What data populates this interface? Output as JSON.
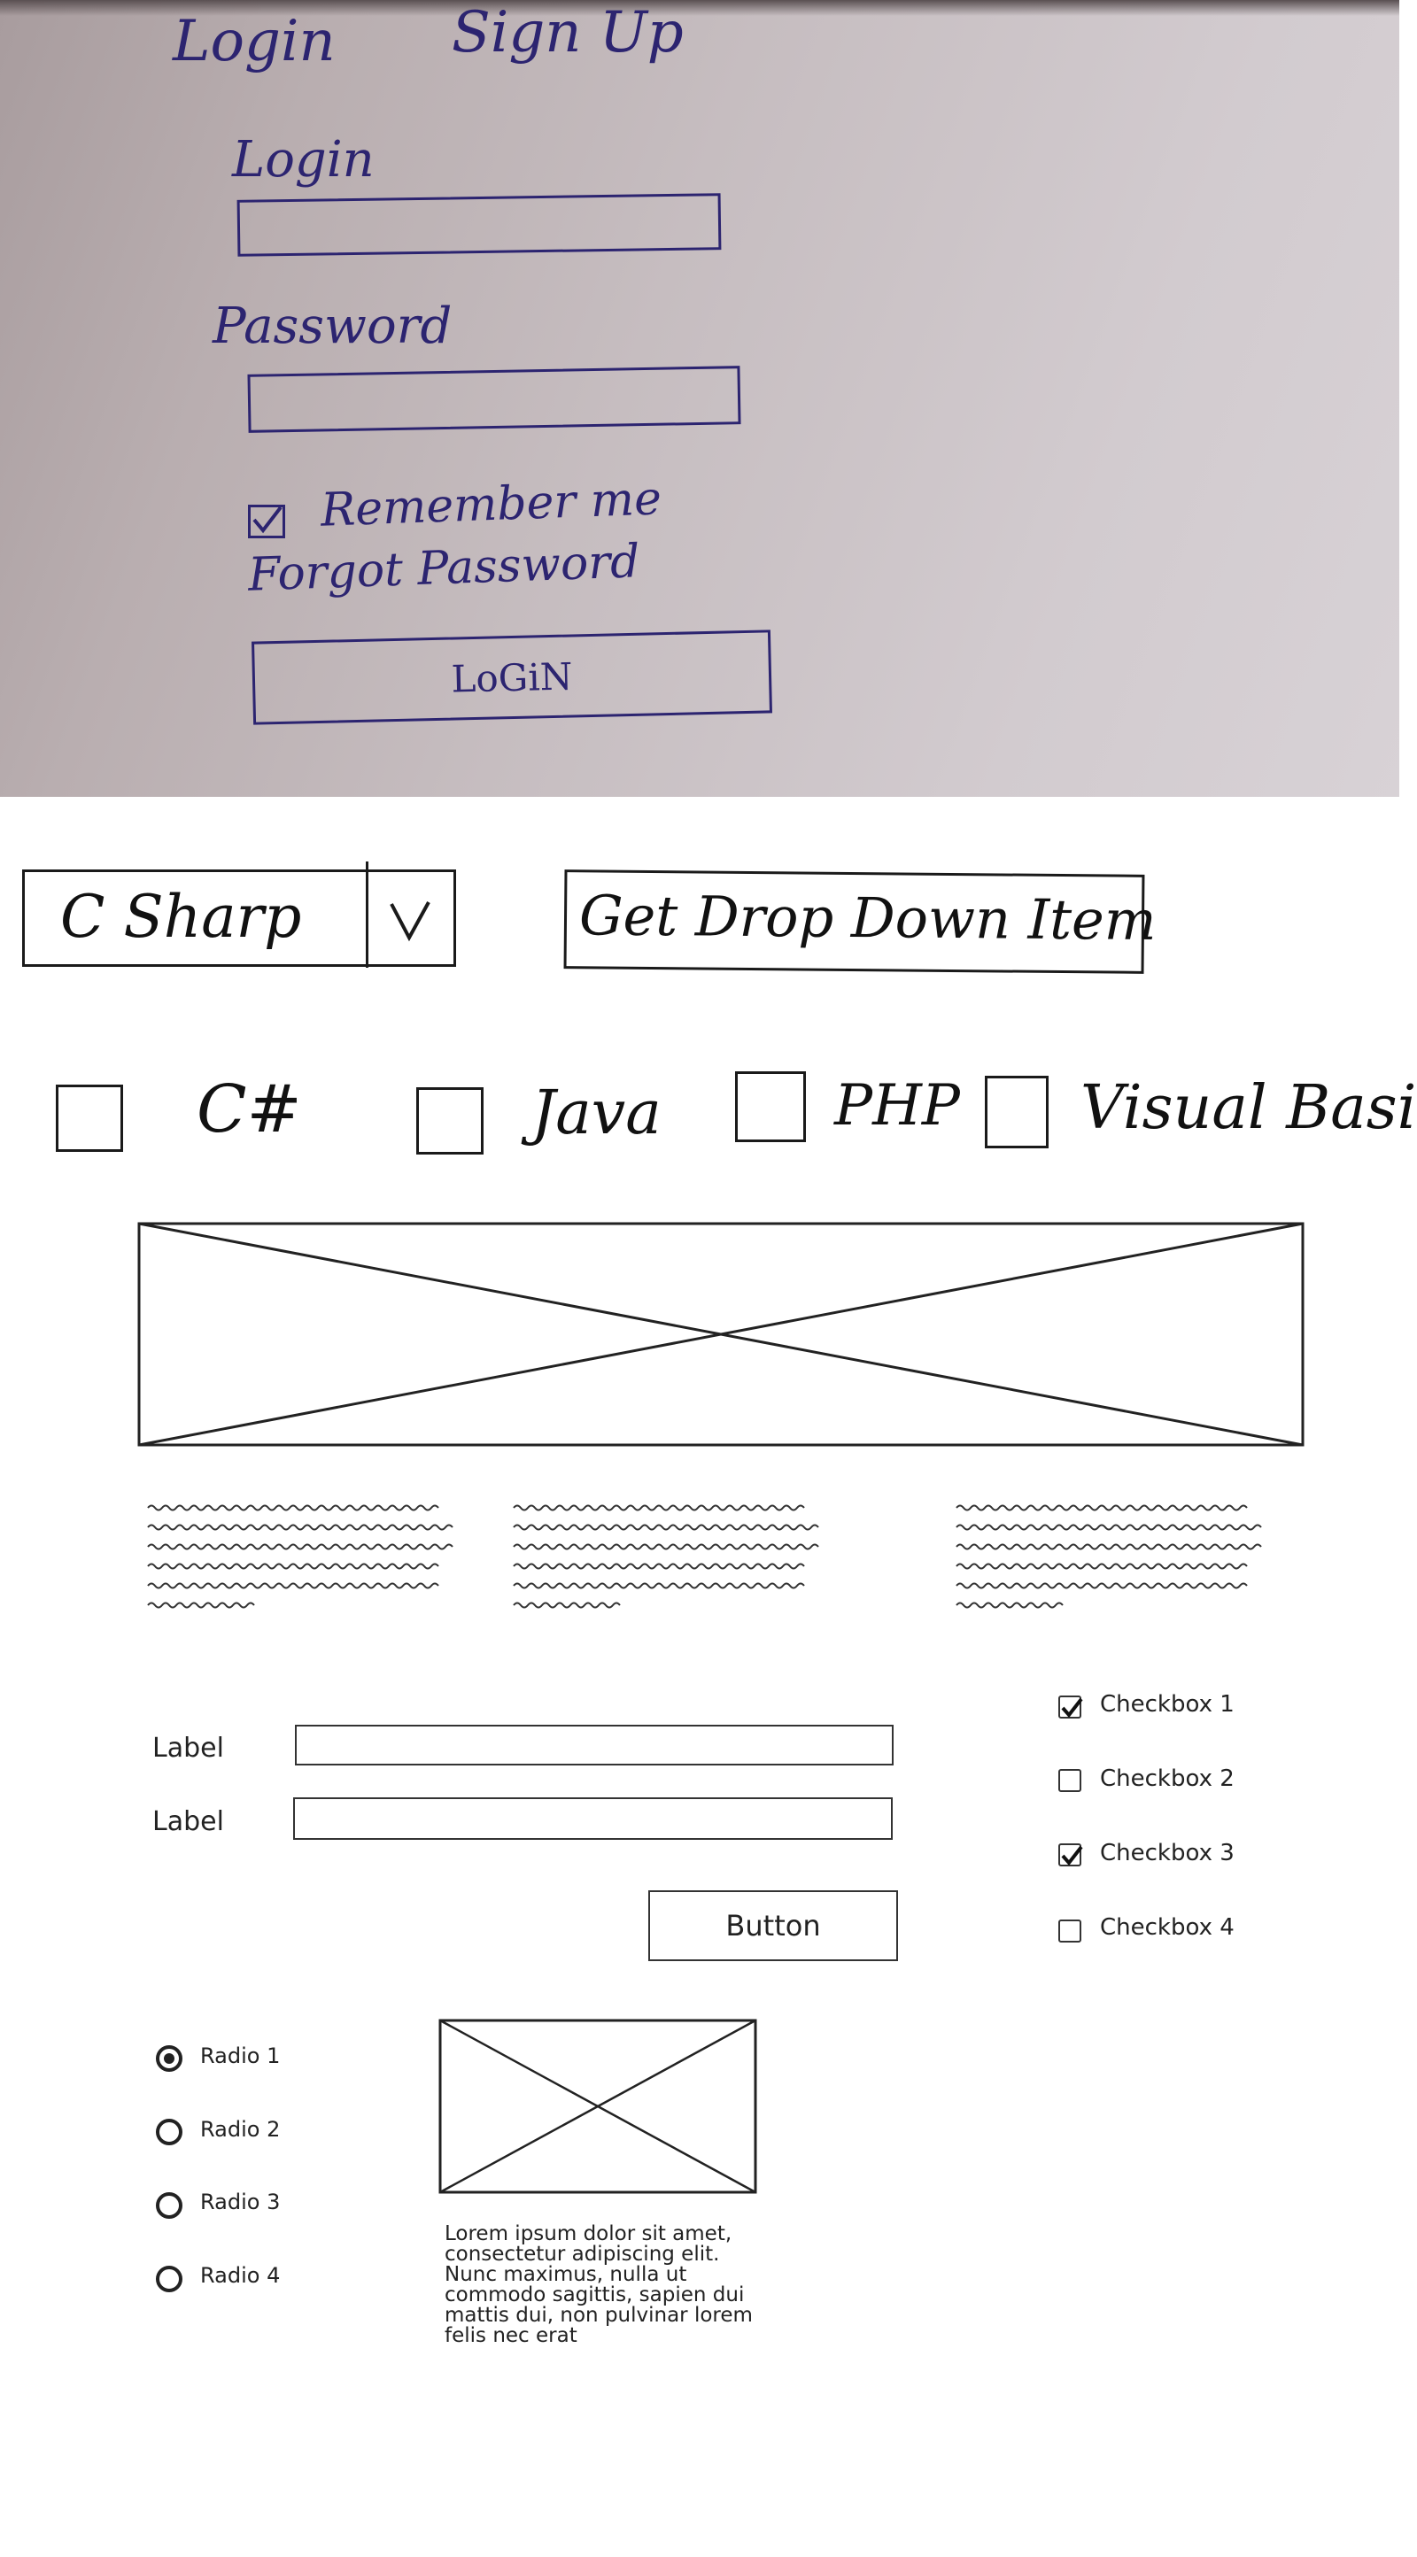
{
  "sketch_photo": {
    "tabs": [
      "Login",
      "Sign Up"
    ],
    "login_label": "Login",
    "password_label": "Password",
    "remember_me": "Remember me",
    "forgot_password": "Forgot Password",
    "login_button": "LoGiN"
  },
  "controls": {
    "combo_value": "C Sharp",
    "dropdown_button": "Get Drop Down Item",
    "languages": [
      "C#",
      "Java",
      "PHP",
      "Visual Basic"
    ]
  },
  "form": {
    "labels": [
      "Label",
      "Label"
    ],
    "button": "Button",
    "checkboxes": [
      {
        "label": "Checkbox 1",
        "checked": true
      },
      {
        "label": "Checkbox 2",
        "checked": false
      },
      {
        "label": "Checkbox 3",
        "checked": true
      },
      {
        "label": "Checkbox 4",
        "checked": false
      }
    ],
    "radios": [
      {
        "label": "Radio 1",
        "selected": true
      },
      {
        "label": "Radio 2",
        "selected": false
      },
      {
        "label": "Radio 3",
        "selected": false
      },
      {
        "label": "Radio 4",
        "selected": false
      }
    ],
    "paragraph": "Lorem ipsum dolor sit amet, consectetur adipiscing elit. Nunc maximus, nulla ut commodo sagittis, sapien dui mattis dui, non pulvinar lorem felis nec erat"
  }
}
